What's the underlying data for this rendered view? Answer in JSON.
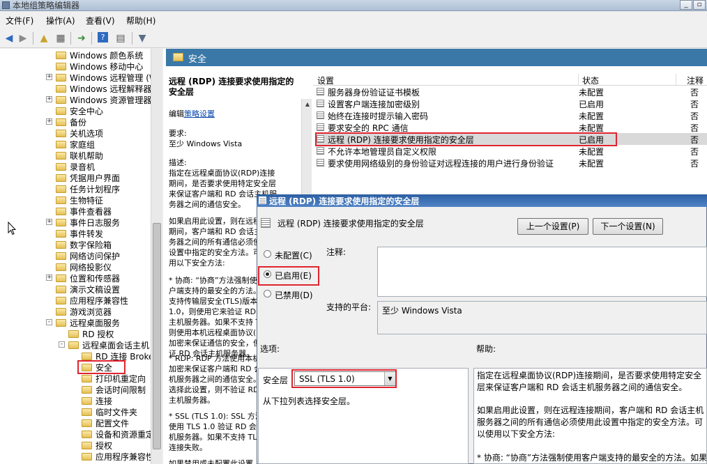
{
  "window": {
    "title": "本地组策略编辑器",
    "min": "_",
    "restore": "▫"
  },
  "menu": [
    "文件(F)",
    "操作(A)",
    "查看(V)",
    "帮助(H)"
  ],
  "toolbar": {
    "icons": [
      "back-icon",
      "forward-icon",
      "up-folder-icon",
      "show-tree-icon",
      "export-icon",
      "help-icon",
      "properties-icon",
      "filter-icon"
    ]
  },
  "tree": {
    "items": [
      {
        "label": "Windows 颜色系统",
        "expander": ""
      },
      {
        "label": "Windows 移动中心",
        "expander": ""
      },
      {
        "label": "Windows 远程管理 (W",
        "expander": "+"
      },
      {
        "label": "Windows 远程解释器",
        "expander": ""
      },
      {
        "label": "Windows 资源管理器",
        "expander": "+"
      },
      {
        "label": "安全中心",
        "expander": ""
      },
      {
        "label": "备份",
        "expander": "+"
      },
      {
        "label": "关机选项",
        "expander": ""
      },
      {
        "label": "家庭组",
        "expander": ""
      },
      {
        "label": "联机帮助",
        "expander": ""
      },
      {
        "label": "录音机",
        "expander": ""
      },
      {
        "label": "凭据用户界面",
        "expander": ""
      },
      {
        "label": "任务计划程序",
        "expander": ""
      },
      {
        "label": "生物特征",
        "expander": ""
      },
      {
        "label": "事件查看器",
        "expander": ""
      },
      {
        "label": "事件日志服务",
        "expander": "+"
      },
      {
        "label": "事件转发",
        "expander": ""
      },
      {
        "label": "数字保险箱",
        "expander": ""
      },
      {
        "label": "网络访问保护",
        "expander": ""
      },
      {
        "label": "网络投影仪",
        "expander": ""
      },
      {
        "label": "位置和传感器",
        "expander": "+"
      },
      {
        "label": "演示文稿设置",
        "expander": ""
      },
      {
        "label": "应用程序兼容性",
        "expander": ""
      },
      {
        "label": "游戏浏览器",
        "expander": ""
      },
      {
        "label": "远程桌面服务",
        "expander": "-"
      }
    ],
    "rds_children": [
      {
        "label": "RD 授权",
        "expander": ""
      },
      {
        "label": "远程桌面会话主机",
        "expander": "-"
      }
    ],
    "rdsh_children": [
      "RD 连接 Broke",
      "安全",
      "打印机重定向",
      "会话时间限制",
      "连接",
      "临时文件夹",
      "配置文件",
      "设备和资源重定",
      "授权",
      "应用程序兼容性"
    ]
  },
  "section": {
    "title": "安全"
  },
  "description": {
    "title": "远程 (RDP) 连接要求使用指定的安全层",
    "edit_prefix": "编辑",
    "edit_link": "策略设置",
    "req_label": "要求:",
    "req_value": "至少 Windows Vista",
    "desc_label": "描述:",
    "desc_text": "指定在远程桌面协议(RDP)连接期间，是否要求使用特定安全层来保证客户端和 RD 会话主机服务器之间的通信安全。",
    "p2": "如果启用此设置，则在远程连接期间，客户端和 RD 会话主机服务器之间的所有通信必须使用此设置中指定的安全方法。可以使用以下安全方法:",
    "p3": "* 协商: “协商”方法强制使用客户端支持的最安全的方法。如果支持传输层安全(TLS)版本 1.0，则使用它来验证 RD 会话主机服务器。如果不支持 TLS，则使用本机远程桌面协议(RDP)加密来保证通信的安全，但不验证 RD 会话主机服务器。",
    "p4": "* RDP: RDP 方法使用本机 RDP 加密来保证客户端和 RD 会话主机服务器之间的通信安全。如果选择此设置，则不验证 RD 会话主机服务器。",
    "p5": "* SSL (TLS 1.0): SSL 方法要求使用 TLS 1.0 验证 RD 会话主机服务器。如果不支持 TLS，则连接失败。",
    "p6": "如果禁用或未配置此设置"
  },
  "list": {
    "headers": {
      "setting": "设置",
      "state": "状态",
      "comment": "注释"
    },
    "rows": [
      {
        "name": "服务器身份验证证书模板",
        "state": "未配置",
        "comment": "否"
      },
      {
        "name": "设置客户端连接加密级别",
        "state": "已启用",
        "comment": "否"
      },
      {
        "name": "始终在连接时提示输入密码",
        "state": "未配置",
        "comment": "否"
      },
      {
        "name": "要求安全的 RPC 通信",
        "state": "未配置",
        "comment": "否"
      },
      {
        "name": "远程 (RDP) 连接要求使用指定的安全层",
        "state": "已启用",
        "comment": "否"
      },
      {
        "name": "不允许本地管理员自定义权限",
        "state": "未配置",
        "comment": "否"
      },
      {
        "name": "要求使用网络级别的身份验证对远程连接的用户进行身份验证",
        "state": "未配置",
        "comment": "否"
      }
    ]
  },
  "dialog": {
    "title": "远程 (RDP) 连接要求使用指定的安全层",
    "setting_name": "远程 (RDP) 连接要求使用指定的安全层",
    "prev_btn": "上一个设置(P)",
    "next_btn": "下一个设置(N)",
    "radio_not_configured": "未配置(C)",
    "radio_enabled": "已启用(E)",
    "radio_disabled": "已禁用(D)",
    "comment_label": "注释:",
    "platform_label": "支持的平台:",
    "platform_value": "至少 Windows Vista",
    "options_label": "选项:",
    "help_label": "帮助:",
    "security_layer_label": "安全层",
    "security_layer_value": "SSL (TLS 1.0)",
    "security_layer_hint": "从下拉列表选择安全层。",
    "help_p1": "指定在远程桌面协议(RDP)连接期间，是否要求使用特定安全层来保证客户端和 RD 会话主机服务器之间的通信安全。",
    "help_p2": "如果启用此设置，则在远程连接期间，客户端和 RD 会话主机服务器之间的所有通信必须使用此设置中指定的安全方法。可以使用以下安全方法:",
    "help_p3": "* 协商: “协商”方法强制使用客户端支持的最安全的方法。如果"
  }
}
